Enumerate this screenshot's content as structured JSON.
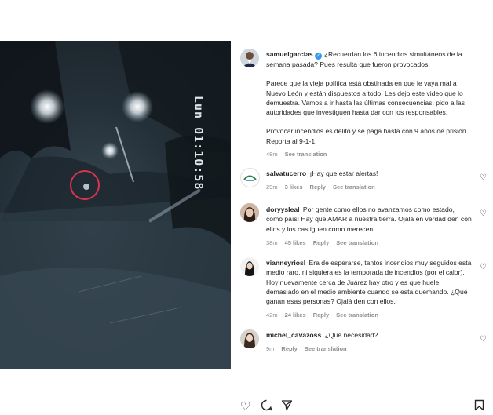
{
  "video": {
    "timestamp": "Lun 01:10:58"
  },
  "caption": {
    "username": "samuelgarcias",
    "paragraphs": [
      "¿Recuerdan los 6 incendios simultáneos de la semana pasada? Pues resulta que fueron provocados.",
      "Parece que la vieja política está obstinada en que le vaya mal a Nuevo León y están dispuestos a todo. Les dejo este video que lo demuestra. Vamos a ir hasta las últimas consecuencias, pido a las autoridades que investiguen hasta dar con los responsables.",
      "Provocar incendios es delito y se paga hasta con 9 años de prisión. Reporta al 9-1-1."
    ],
    "time": "48m",
    "see_translation": "See translation"
  },
  "comments": [
    {
      "username": "salvatucerro",
      "text": "¡Hay que estar alertas!",
      "time": "29m",
      "likes": "3 likes",
      "reply": "Reply",
      "see_translation": "See translation"
    },
    {
      "username": "doryysleal",
      "text": "Por gente como ellos no avanzamos como estado, como país! Hay que AMAR a nuestra tierra. Ojalá en verdad den con ellos y los castiguen como merecen.",
      "time": "38m",
      "likes": "45 likes",
      "reply": "Reply",
      "see_translation": "See translation"
    },
    {
      "username": "vianneyriosl",
      "text": "Era de esperarse, tantos incendios muy seguidos esta medio raro, ni siquiera es la temporada de incendios (por el calor). Hoy nuevamente cerca de Juárez hay otro y es que huele demasiado en el medio ambiente cuando se esta quemando. ¿Qué ganan esas personas? Ojalá den con ellos.",
      "time": "42m",
      "likes": "24 likes",
      "reply": "Reply",
      "see_translation": "See translation"
    },
    {
      "username": "michel_cavazoss",
      "text": "¿Que necesidad?",
      "time": "9m",
      "reply": "Reply",
      "see_translation": "See translation"
    }
  ],
  "icons": {
    "like": "heart-icon",
    "comment": "comment-icon",
    "share": "share-icon",
    "save": "bookmark-icon"
  },
  "colors": {
    "verified": "#3897f0",
    "highlight_circle": "#d9334d"
  }
}
